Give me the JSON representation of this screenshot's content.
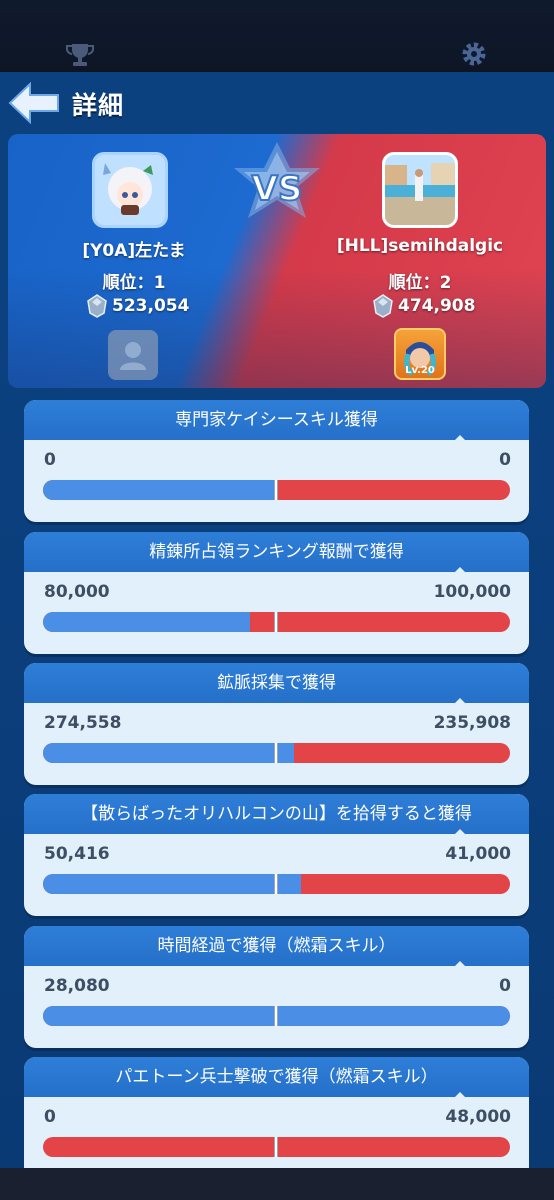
{
  "header": {
    "title": "詳細"
  },
  "players": {
    "left": {
      "name": "[Y0A]左たま",
      "rank": "順位：1",
      "score": "523,054"
    },
    "right": {
      "name": "[HLL]semihdalgic",
      "rank": "順位：2",
      "score": "474,908",
      "level": "Lv.20"
    },
    "vs_label": "VS"
  },
  "stats": [
    {
      "title": "専門家ケイシースキル獲得",
      "left": "0",
      "right": "0",
      "left_share": 0.5
    },
    {
      "title": "精錬所占領ランキング報酬で獲得",
      "left": "80,000",
      "right": "100,000",
      "left_share": 0.444
    },
    {
      "title": "鉱脈採集で獲得",
      "left": "274,558",
      "right": "235,908",
      "left_share": 0.538
    },
    {
      "title": "【散らばったオリハルコンの山】を拾得すると獲得",
      "left": "50,416",
      "right": "41,000",
      "left_share": 0.552
    },
    {
      "title": "時間経過で獲得（燃霜スキル）",
      "left": "28,080",
      "right": "0",
      "left_share": 1.0
    },
    {
      "title": "パエトーン兵士撃破で獲得（燃霜スキル）",
      "left": "0",
      "right": "48,000",
      "left_share": 0.0
    }
  ],
  "colors": {
    "blue": "#4a8ee6",
    "red": "#e34448",
    "card": "#e2f0fb",
    "panel": "#0c4180"
  },
  "icons": {
    "top_left": "trophy-icon",
    "top_right": "gear-icon",
    "back": "back-arrow-icon",
    "currency": "orichalcum-gem-icon"
  }
}
